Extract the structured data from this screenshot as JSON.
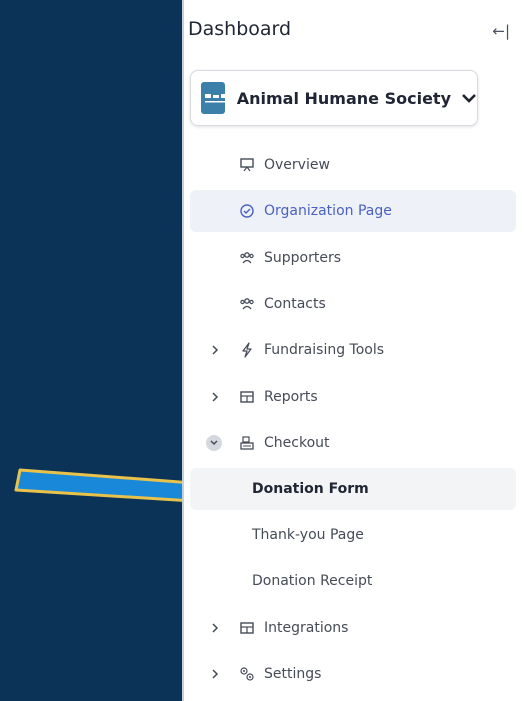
{
  "sidebar": {
    "title": "Dashboard",
    "collapse_icon": "collapse-left-icon",
    "org": {
      "name": "Animal Humane Society",
      "logo_icon": "org-logo",
      "chevron": "chevron-down-icon"
    },
    "items": [
      {
        "label": "Overview",
        "icon": "presentation-icon"
      },
      {
        "label": "Organization Page",
        "icon": "check-circle-icon"
      },
      {
        "label": "Supporters",
        "icon": "users-icon"
      },
      {
        "label": "Contacts",
        "icon": "users-icon"
      },
      {
        "label": "Fundraising Tools",
        "icon": "lightning-icon"
      },
      {
        "label": "Reports",
        "icon": "table-icon"
      },
      {
        "label": "Checkout",
        "icon": "cash-register-icon"
      },
      {
        "label": "Donation Form"
      },
      {
        "label": "Thank-you Page"
      },
      {
        "label": "Donation Receipt"
      },
      {
        "label": "Integrations",
        "icon": "table-icon"
      },
      {
        "label": "Settings",
        "icon": "gears-icon"
      }
    ]
  },
  "colors": {
    "background": "#0b3358",
    "accent": "#4a61c4",
    "arrow_fill": "#1a88d8",
    "arrow_outline": "#e8c24a"
  }
}
